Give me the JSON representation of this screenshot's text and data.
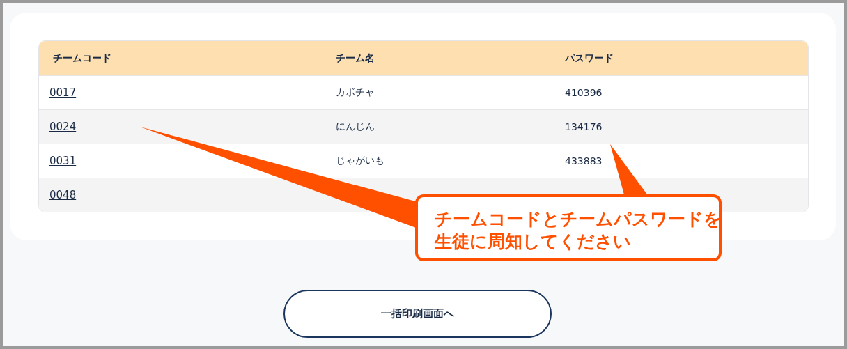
{
  "table": {
    "columns": [
      "チームコード",
      "チーム名",
      "パスワード"
    ],
    "rows": [
      {
        "code": "0017",
        "name": "カボチャ",
        "password": "410396"
      },
      {
        "code": "0024",
        "name": "にんじん",
        "password": "134176"
      },
      {
        "code": "0031",
        "name": "じゃがいも",
        "password": "433883"
      },
      {
        "code": "0048"
      }
    ]
  },
  "callout": {
    "lines": [
      "チームコードとチームパスワードを",
      "生徒に周知してください"
    ]
  },
  "print_button": {
    "label": "一括印刷画面へ"
  }
}
